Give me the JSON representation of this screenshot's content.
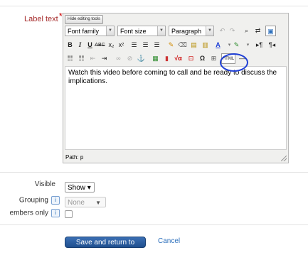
{
  "label_text": {
    "label": "Label text",
    "required_mark": "*"
  },
  "editor": {
    "hide_tools": "Hide editing tools",
    "font_family": "Font family",
    "font_size": "Font size",
    "paragraph": "Paragraph",
    "html_button": "HTML",
    "content": "Watch this video before coming to call and be ready to discuss the implications.",
    "path": "Path: p"
  },
  "settings": {
    "visible": {
      "label": "Visible",
      "value": "Show ▾"
    },
    "grouping": {
      "label": "Grouping",
      "value": "None"
    },
    "members_only": {
      "label": "embers only"
    }
  },
  "actions": {
    "save": "Save and return to course",
    "cancel": "Cancel"
  },
  "colors": {
    "accent": "#1f3fd6",
    "save_button": "#2a5ba0",
    "link": "#2a6ebb"
  }
}
